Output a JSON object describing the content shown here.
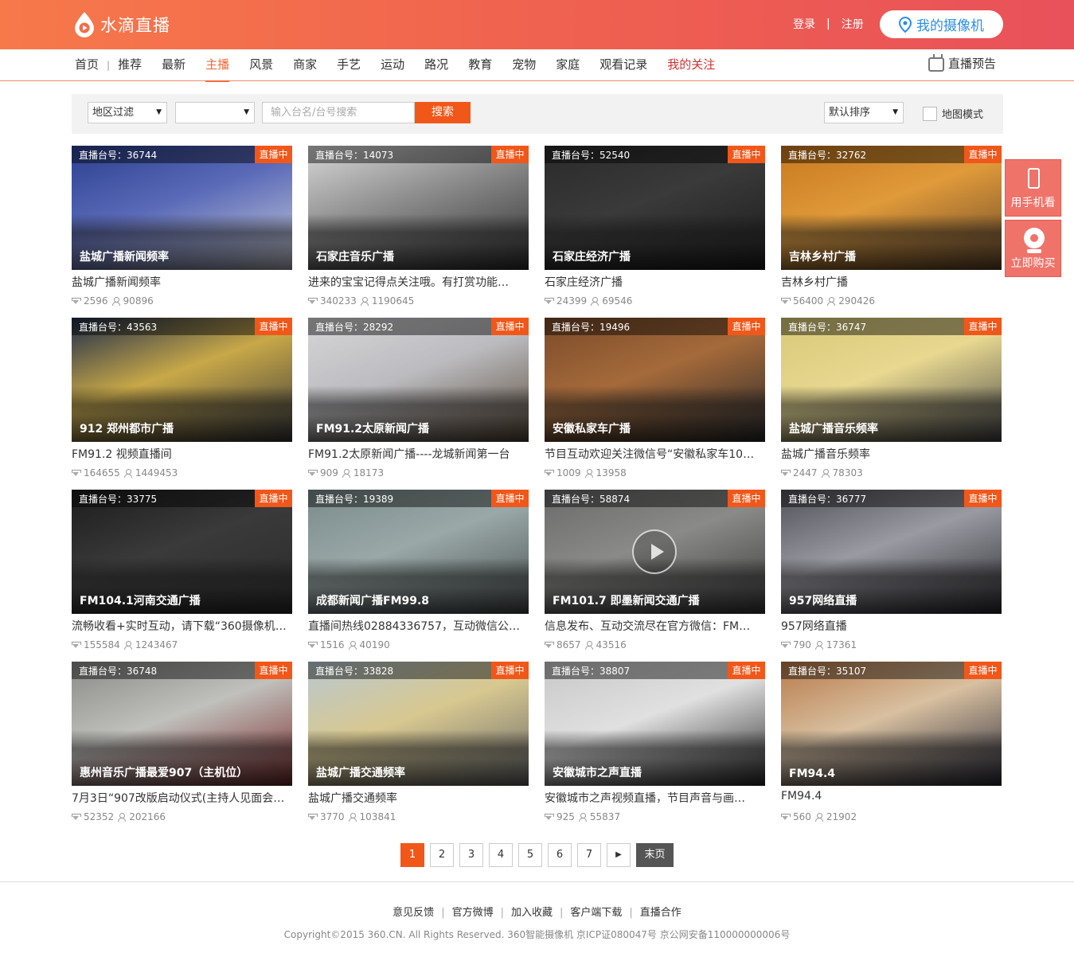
{
  "header": {
    "logo_text": "水滴直播",
    "login": "登录",
    "sep": "|",
    "register": "注册",
    "my_camera": "我的摄像机"
  },
  "nav": {
    "items": [
      "首页",
      "推荐",
      "最新",
      "主播",
      "风景",
      "商家",
      "手艺",
      "运动",
      "路况",
      "教育",
      "宠物",
      "家庭",
      "观看记录",
      "我的关注"
    ],
    "active": "主播",
    "preview": "直播预告"
  },
  "filter": {
    "region": "地区过滤",
    "region2": "",
    "search_placeholder": "输入台名/台号搜索",
    "search_button": "搜索",
    "sort": "默认排序",
    "map_mode": "地图模式"
  },
  "live_label": "直播中",
  "cards": [
    {
      "num": "直播台号：36744",
      "overlay": "盐城广播新闻频率",
      "desc": "盐城广播新闻频率",
      "gems": "2596",
      "views": "90896",
      "colors": [
        "#2a3f8f",
        "#5a6ab8",
        "#c9ccd8"
      ]
    },
    {
      "num": "直播台号：14073",
      "overlay": "石家庄音乐广播",
      "desc": "进来的宝宝记得点关注哦。有打赏功能…",
      "gems": "340233",
      "views": "1190645",
      "colors": [
        "#d8d8d8",
        "#8a8a8a",
        "#2e2e2e"
      ]
    },
    {
      "num": "直播台号：52540",
      "overlay": "石家庄经济广播",
      "desc": "石家庄经济广播",
      "gems": "24399",
      "views": "69546",
      "colors": [
        "#2a2a2a",
        "#3a3a3a",
        "#1a1a1a"
      ]
    },
    {
      "num": "直播台号：32762",
      "overlay": "吉林乡村广播",
      "desc": "吉林乡村广播",
      "gems": "56400",
      "views": "290426",
      "colors": [
        "#c8781e",
        "#e09a3a",
        "#6a4a2a"
      ]
    },
    {
      "num": "直播台号：43563",
      "overlay": "912 郑州都市广播",
      "desc": "FM91.2 视频直播间",
      "gems": "164655",
      "views": "1449453",
      "colors": [
        "#1e2c4a",
        "#c8a848",
        "#3a3a3a"
      ]
    },
    {
      "num": "直播台号：28292",
      "overlay": "FM91.2太原新闻广播",
      "desc": "FM91.2太原新闻广播----龙城新闻第一台",
      "gems": "909",
      "views": "18173",
      "colors": [
        "#d6d6d8",
        "#bcbcc0",
        "#5a4a3a"
      ]
    },
    {
      "num": "直播台号：19496",
      "overlay": "安徽私家车广播",
      "desc": "节目互动欢迎关注微信号“安徽私家车10…",
      "gems": "1009",
      "views": "13958",
      "colors": [
        "#7a4a2a",
        "#a56a3a",
        "#2a2a2a"
      ]
    },
    {
      "num": "直播台号：36747",
      "overlay": "盐城广播音乐频率",
      "desc": "盐城广播音乐频率",
      "gems": "2447",
      "views": "78303",
      "colors": [
        "#d8c878",
        "#e8d890",
        "#4a4a4a"
      ]
    },
    {
      "num": "直播台号：33775",
      "overlay": "FM104.1河南交通广播",
      "desc": "流畅收看+实时互动，请下载“360摄像机…",
      "gems": "155584",
      "views": "1243467",
      "colors": [
        "#1c1c1c",
        "#3a3a3a",
        "#2a2a2a"
      ]
    },
    {
      "num": "直播台号：19389",
      "overlay": "成都新闻广播FM99.8",
      "desc": "直播间热线02884336757，互动微信公众…",
      "gems": "1516",
      "views": "40190",
      "colors": [
        "#7a8a8a",
        "#9aa8a8",
        "#4a5050"
      ]
    },
    {
      "num": "直播台号：58874",
      "overlay": "FM101.7 即墨新闻交通广播",
      "desc": "信息发布、互动交流尽在官方微信：FM…",
      "gems": "8657",
      "views": "43516",
      "colors": [
        "#6a6a6a",
        "#8a8a88",
        "#3a3a3a"
      ]
    },
    {
      "num": "直播台号：36777",
      "overlay": "957网络直播",
      "desc": "957网络直播",
      "gems": "790",
      "views": "17361",
      "colors": [
        "#505058",
        "#9a9aa2",
        "#2a2a30"
      ]
    },
    {
      "num": "直播台号：36748",
      "overlay": "惠州音乐广播最爱907（主机位）",
      "desc": "7月3日“907改版启动仪式(主持人见面会…",
      "gems": "52352",
      "views": "202166",
      "colors": [
        "#8a8a88",
        "#c0c0bc",
        "#7a2a2a"
      ]
    },
    {
      "num": "直播台号：33828",
      "overlay": "盐城广播交通频率",
      "desc": "盐城广播交通频率",
      "gems": "3770",
      "views": "103841",
      "colors": [
        "#b8c8d0",
        "#d8c890",
        "#6a6a6a"
      ]
    },
    {
      "num": "直播台号：38807",
      "overlay": "安徽城市之声直播",
      "desc": "安徽城市之声视频直播，节目声音与画…",
      "gems": "925",
      "views": "55837",
      "colors": [
        "#c8c8c8",
        "#e0e0e0",
        "#2a2a2a"
      ]
    },
    {
      "num": "直播台号：35107",
      "overlay": "FM94.4",
      "desc": "FM94.4",
      "gems": "560",
      "views": "21902",
      "colors": [
        "#b87a4a",
        "#d8c0a0",
        "#2a2a3a"
      ]
    }
  ],
  "side": {
    "mobile": "用手机看",
    "buy": "立即购买"
  },
  "pager": {
    "pages": [
      "1",
      "2",
      "3",
      "4",
      "5",
      "6",
      "7"
    ],
    "next": "▶",
    "last": "末页"
  },
  "footer": {
    "links": [
      "意见反馈",
      "官方微博",
      "加入收藏",
      "客户端下载",
      "直播合作"
    ],
    "copyright": "Copyright©2015 360.CN. All Rights Reserved. 360智能摄像机 京ICP证080047号 京公网安备110000000006号"
  }
}
